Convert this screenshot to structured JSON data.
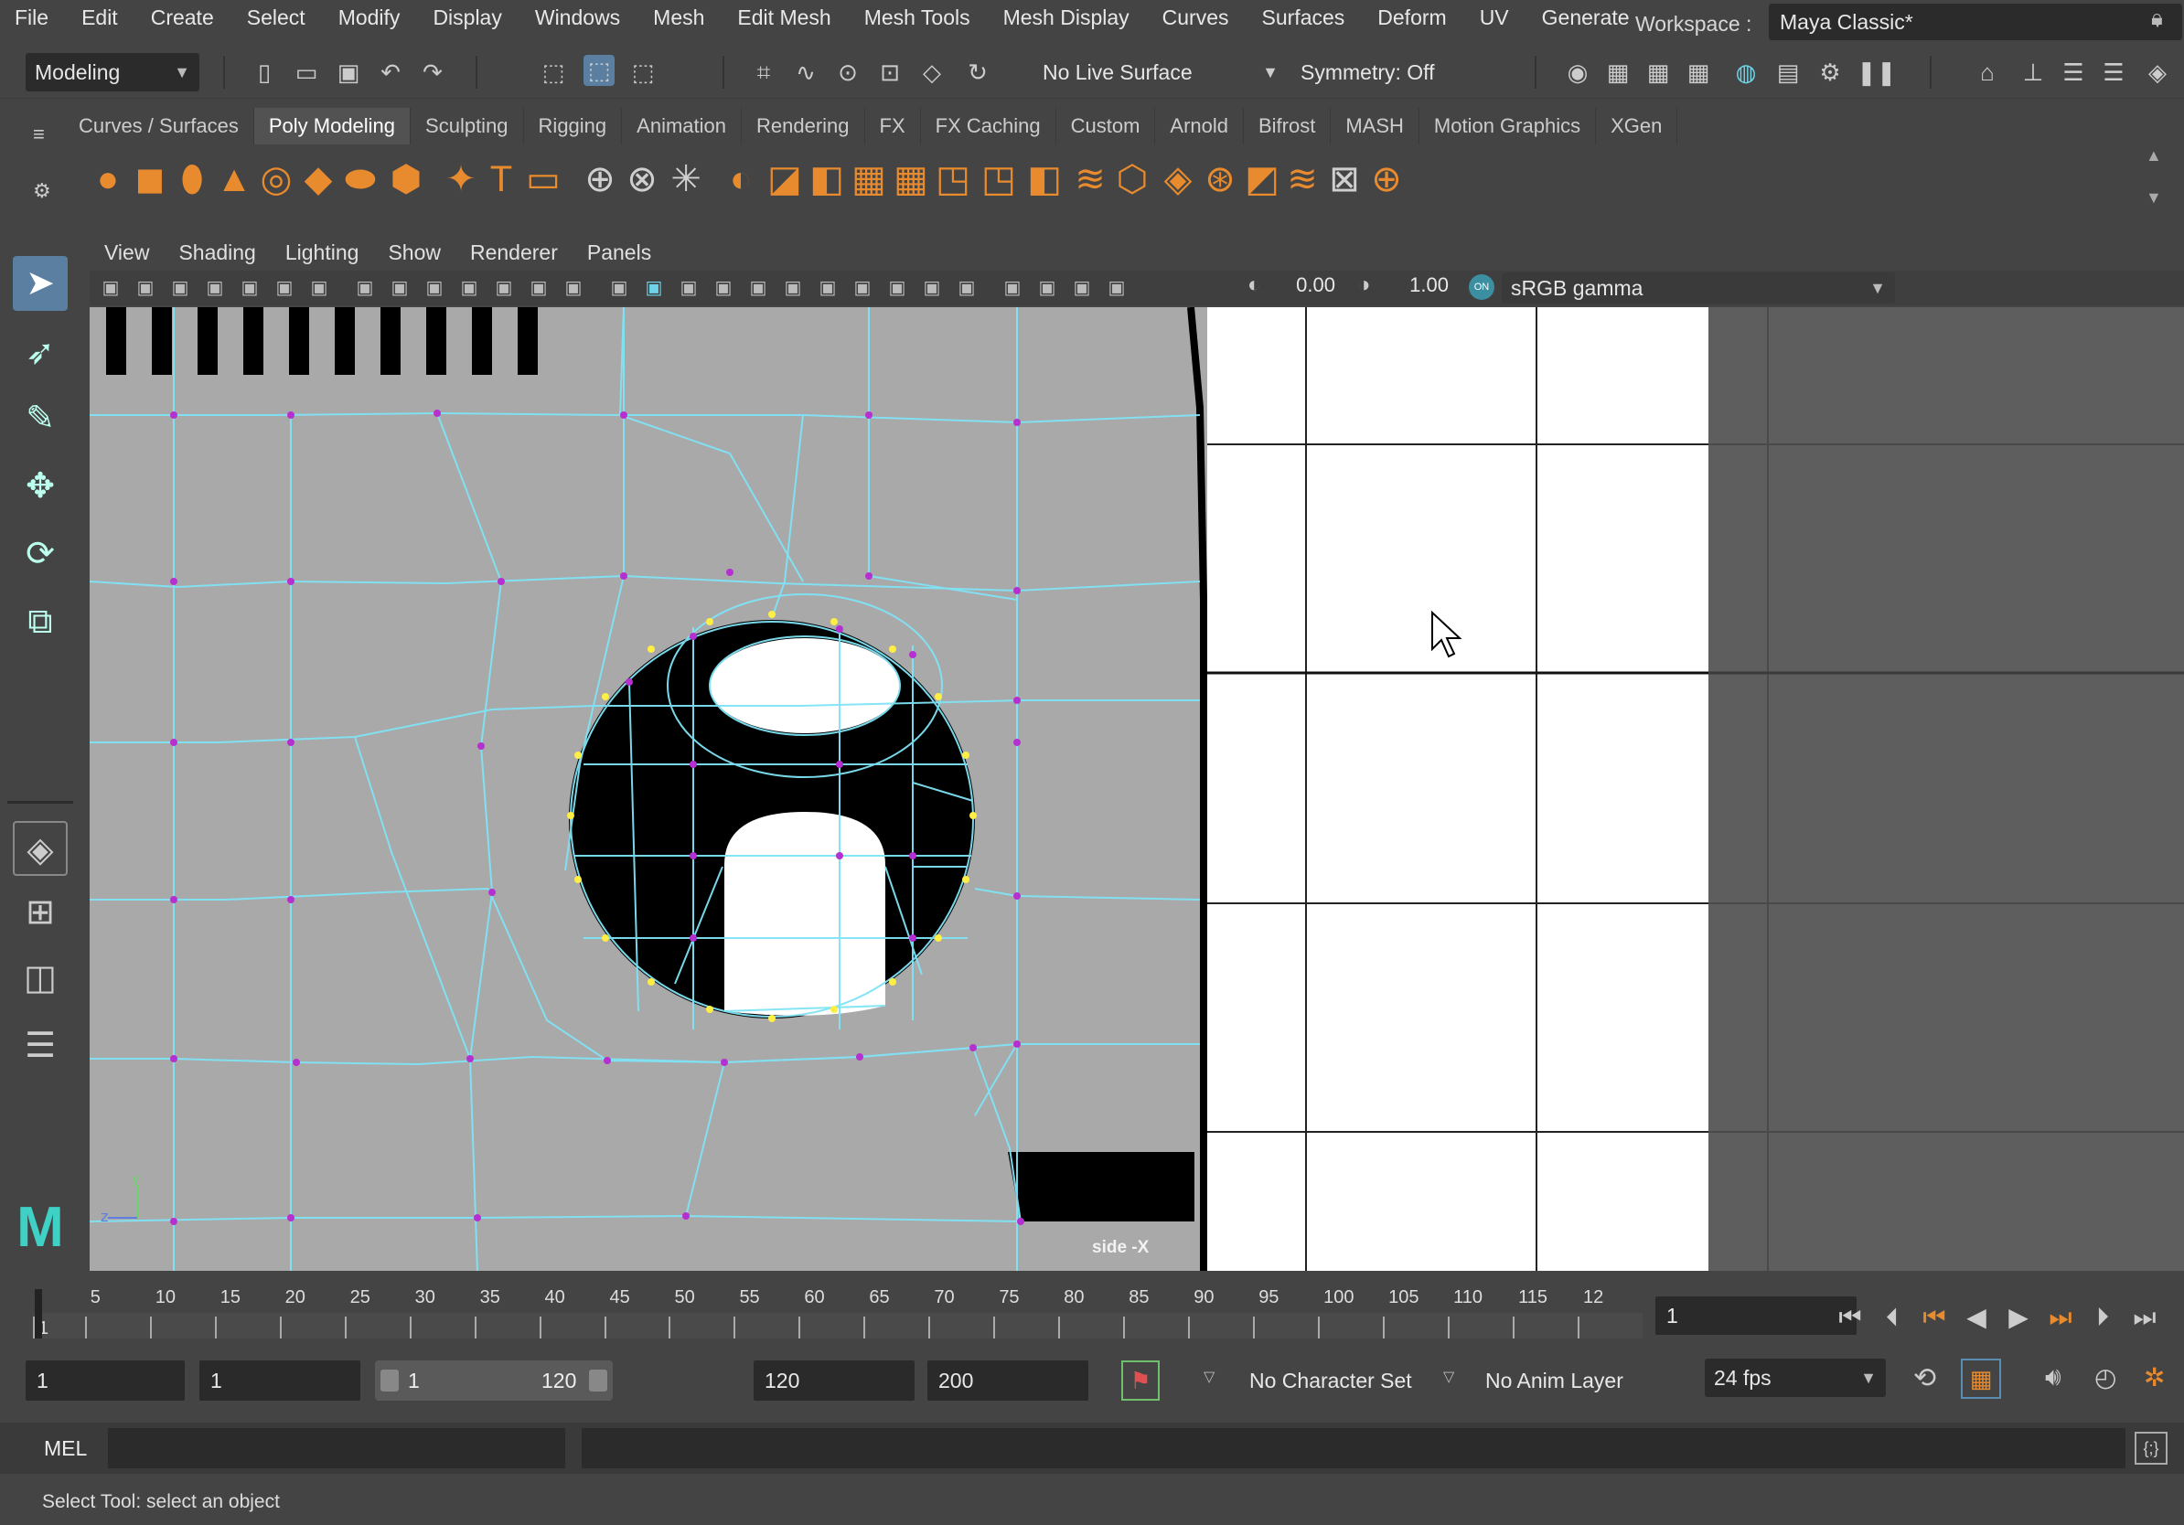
{
  "menubar": {
    "items": [
      "File",
      "Edit",
      "Create",
      "Select",
      "Modify",
      "Display",
      "Windows",
      "Mesh",
      "Edit Mesh",
      "Mesh Tools",
      "Mesh Display",
      "Curves",
      "Surfaces",
      "Deform",
      "UV",
      "Generate"
    ],
    "workspace_label": "Workspace :",
    "workspace_value": "Maya Classic*"
  },
  "statusline": {
    "menu_set": "Modeling",
    "live_surface": "No Live Surface",
    "symmetry": "Symmetry: Off"
  },
  "shelf": {
    "tabs": [
      "Curves / Surfaces",
      "Poly Modeling",
      "Sculpting",
      "Rigging",
      "Animation",
      "Rendering",
      "FX",
      "FX Caching",
      "Custom",
      "Arnold",
      "Bifrost",
      "MASH",
      "Motion Graphics",
      "XGen"
    ],
    "active_tab": "Poly Modeling"
  },
  "panel": {
    "menus": [
      "View",
      "Shading",
      "Lighting",
      "Show",
      "Renderer",
      "Panels"
    ],
    "exposure": "0.00",
    "gamma": "1.00",
    "color_space": "sRGB gamma",
    "camera_label": "side -X"
  },
  "timeline": {
    "ticks": [
      "1",
      "5",
      "10",
      "15",
      "20",
      "25",
      "30",
      "35",
      "40",
      "45",
      "50",
      "55",
      "60",
      "65",
      "70",
      "75",
      "80",
      "85",
      "90",
      "95",
      "100",
      "105",
      "110",
      "115",
      "12"
    ],
    "current_frame": "1"
  },
  "range": {
    "start": "1",
    "playback_start": "1",
    "slider_start": "1",
    "slider_end": "120",
    "playback_end": "120",
    "end": "200",
    "character_set": "No Character Set",
    "anim_layer": "No Anim Layer",
    "fps": "24 fps"
  },
  "cmdline": {
    "language": "MEL"
  },
  "helpline": {
    "text": "Select Tool: select an object"
  },
  "colors": {
    "wire": "#7fe3f5",
    "vertex": "#b52fd1",
    "selected_vertex": "#ffee44",
    "accent_orange": "#e88a2e"
  }
}
